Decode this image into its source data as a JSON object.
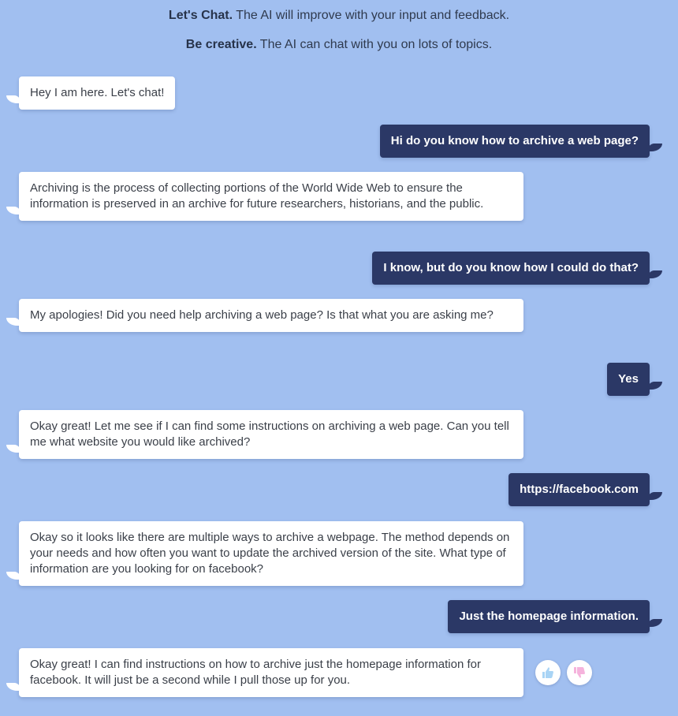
{
  "intro": {
    "line1_bold": "Let's Chat.",
    "line1_rest": " The AI will improve with your input and feedback.",
    "line2_bold": "Be creative.",
    "line2_rest": " The AI can chat with you on lots of topics."
  },
  "messages": [
    {
      "role": "bot",
      "text": "Hey I am here. Let's chat!"
    },
    {
      "role": "user",
      "text": "Hi do you know how to archive a web page?"
    },
    {
      "role": "bot",
      "text": "Archiving is the process of collecting portions of the World Wide Web to ensure the information is preserved in an archive for future researchers, historians, and the public."
    },
    {
      "role": "user",
      "text": "I know, but do you know how I could do that?"
    },
    {
      "role": "bot",
      "text": "My apologies! Did you need help archiving a web page? Is that what you are asking me?"
    },
    {
      "role": "user",
      "text": "Yes"
    },
    {
      "role": "bot",
      "text": "Okay great! Let me see if I can find some instructions on archiving a web page. Can you tell me what website you would like archived?"
    },
    {
      "role": "user",
      "text": "https://facebook.com"
    },
    {
      "role": "bot",
      "text": "Okay so it looks like there are multiple ways to archive a webpage. The method depends on your needs and how often you want to update the archived version of the site. What type of information are you looking for on facebook?"
    },
    {
      "role": "user",
      "text": "Just the homepage information."
    },
    {
      "role": "bot",
      "text": "Okay great! I can find instructions on how to archive just the homepage information for facebook. It will just be a second while I pull those up for you."
    }
  ],
  "feedback": {
    "thumbs_up_icon": "thumbs-up-icon",
    "thumbs_down_icon": "thumbs-down-icon",
    "thumbs_up_color": "#a9d4f5",
    "thumbs_down_color": "#f5b3dc"
  },
  "colors": {
    "background": "#a1bff0",
    "user_bubble": "#2b3866",
    "bot_bubble": "#ffffff"
  }
}
